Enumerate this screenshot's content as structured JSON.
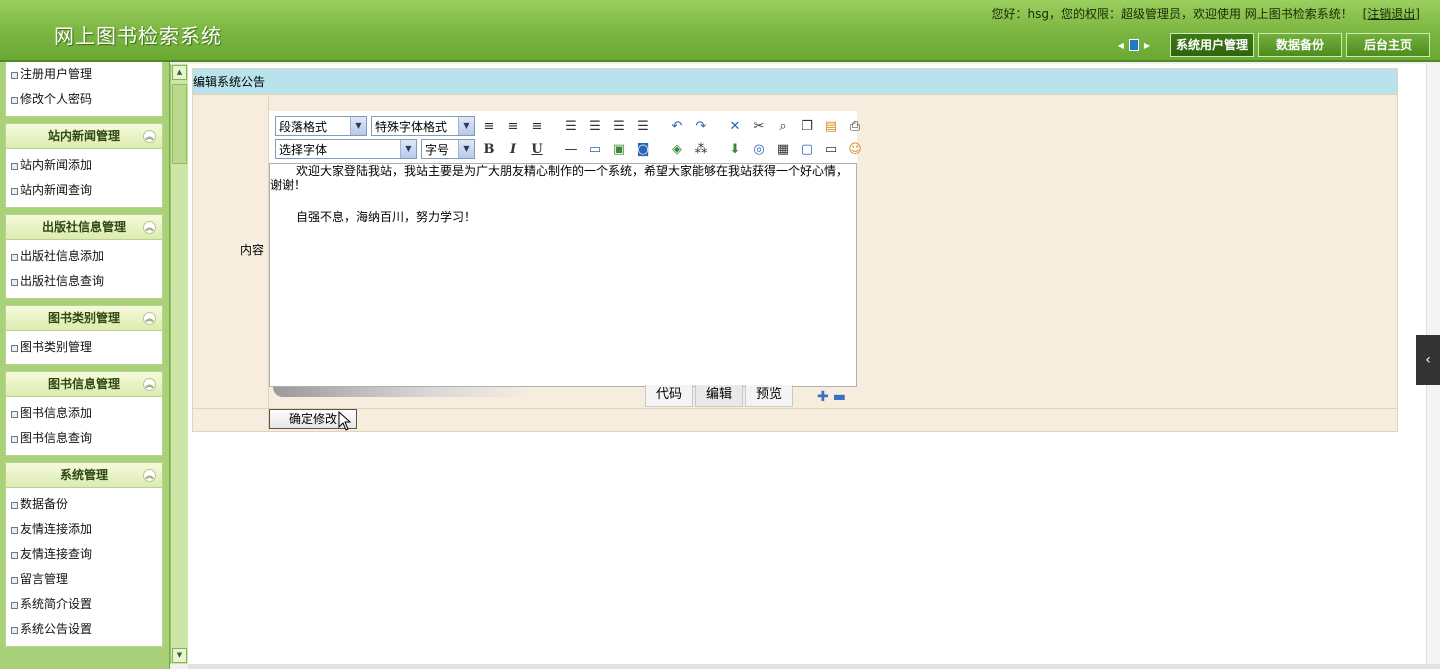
{
  "header": {
    "brand": "网上图书检索系统",
    "greeting": "您好：hsg，您的权限：超级管理员，欢迎使用 网上图书检索系统！",
    "logout": "[注销退出]",
    "nav": [
      "系统用户管理",
      "数据备份",
      "后台主页"
    ]
  },
  "sidebar": {
    "top_items": [
      "注册用户管理",
      "修改个人密码"
    ],
    "sections": [
      {
        "title": "站内新闻管理",
        "items": [
          "站内新闻添加",
          "站内新闻查询"
        ]
      },
      {
        "title": "出版社信息管理",
        "items": [
          "出版社信息添加",
          "出版社信息查询"
        ]
      },
      {
        "title": "图书类别管理",
        "items": [
          "图书类别管理"
        ]
      },
      {
        "title": "图书信息管理",
        "items": [
          "图书信息添加",
          "图书信息查询"
        ]
      },
      {
        "title": "系统管理",
        "items": [
          "数据备份",
          "友情连接添加",
          "友情连接查询",
          "留言管理",
          "系统简介设置",
          "系统公告设置"
        ]
      }
    ]
  },
  "form": {
    "title": "编辑系统公告",
    "content_label": "内容",
    "submit": "确定修改"
  },
  "editor": {
    "paragraph_select": "段落格式",
    "special_select": "特殊字体格式",
    "font_select": "选择字体",
    "size_select": "字号",
    "bold": "B",
    "italic": "I",
    "underline": "U",
    "content_p1": "欢迎大家登陆我站，我站主要是为广大朋友精心制作的一个系统，希望大家能够在我站获得一个好心情，谢谢！",
    "content_p2": "自强不息，海纳百川，努力学习！",
    "modes": [
      "代码",
      "编辑",
      "预览"
    ]
  }
}
